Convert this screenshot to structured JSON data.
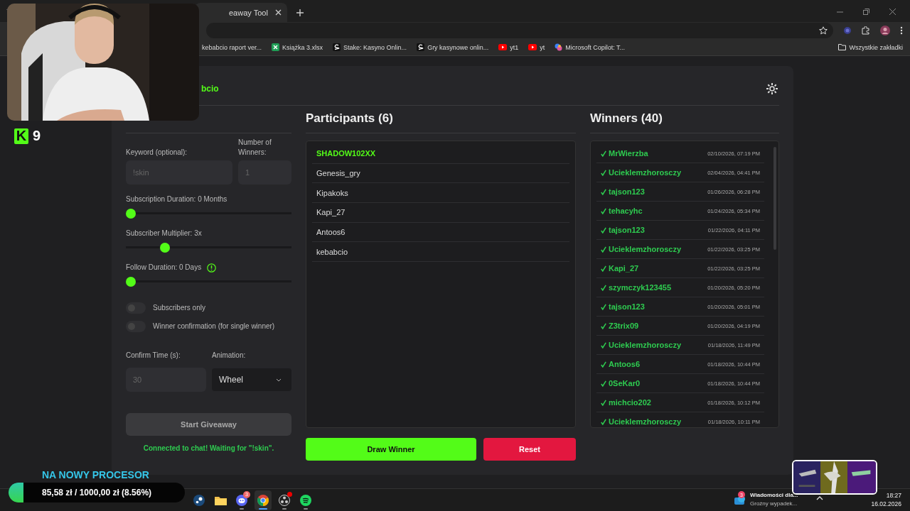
{
  "browser": {
    "tab_title": "eaway Tool",
    "bookmarks": [
      {
        "label": "kebabcio raport ver..."
      },
      {
        "label": "Książka 3.xlsx",
        "kind": "sheet"
      },
      {
        "label": "Stake: Kasyno Onlin...",
        "kind": "stake"
      },
      {
        "label": "Gry kasynowe onlin...",
        "kind": "stake"
      },
      {
        "label": "yt1",
        "kind": "video"
      },
      {
        "label": "yt",
        "kind": "video"
      },
      {
        "label": "Microsoft Copilot: T...",
        "kind": "copilot"
      }
    ],
    "all_bookmarks": "Wszystkie zakładki"
  },
  "page": {
    "title": "bcio",
    "settings": {
      "keyword_label": "Keyword (optional):",
      "keyword_placeholder": "!skin",
      "winners_label": "Number of Winners:",
      "winners_placeholder": "1",
      "sliders": [
        {
          "label": "Subscription Duration: 0 Months",
          "level": 0,
          "info": false
        },
        {
          "label": "Subscriber Multiplier: 3x",
          "level": 0.22,
          "info": false
        },
        {
          "label": "Follow Duration: 0 Days",
          "level": 0,
          "info": true
        }
      ],
      "toggles": [
        {
          "label": "Subscribers only",
          "on": false
        },
        {
          "label": "Winner confirmation (for single winner)",
          "on": false
        }
      ],
      "confirm_label": "Confirm Time (s):",
      "confirm_placeholder": "30",
      "animation_label": "Animation:",
      "animation_value": "Wheel",
      "start_button": "Start Giveaway",
      "start_disabled": true,
      "status": "Connected to chat! Waiting for \"!skin\"."
    },
    "participants": {
      "title": "Participants (6)",
      "items": [
        {
          "name": "SHADOW102XX",
          "selected": true
        },
        {
          "name": "Genesis_gry",
          "selected": false
        },
        {
          "name": "Kipakoks",
          "selected": false
        },
        {
          "name": "Kapi_27",
          "selected": false
        },
        {
          "name": "Antoos6",
          "selected": false
        },
        {
          "name": "kebabcio",
          "selected": false
        }
      ]
    },
    "draw_button": "Draw Winner",
    "reset_button": "Reset",
    "winners": {
      "title": "Winners (40)",
      "items": [
        {
          "name": "MrWierzba",
          "time": "02/10/2026, 07:19 PM"
        },
        {
          "name": "Ucieklemzhorosczy",
          "time": "02/04/2026, 04:41 PM"
        },
        {
          "name": "tajson123",
          "time": "01/26/2026, 06:28 PM"
        },
        {
          "name": "tehacyhc",
          "time": "01/24/2026, 05:34 PM"
        },
        {
          "name": "tajson123",
          "time": "01/22/2026, 04:11 PM"
        },
        {
          "name": "Ucieklemzhorosczy",
          "time": "01/22/2026, 03:25 PM"
        },
        {
          "name": "Kapi_27",
          "time": "01/22/2026, 03:25 PM"
        },
        {
          "name": "szymczyk123455",
          "time": "01/20/2026, 05:20 PM"
        },
        {
          "name": "tajson123",
          "time": "01/20/2026, 05:01 PM"
        },
        {
          "name": "Z3trix09",
          "time": "01/20/2026, 04:19 PM"
        },
        {
          "name": "Ucieklemzhorosczy",
          "time": "01/18/2026, 11:49 PM"
        },
        {
          "name": "Antoos6",
          "time": "01/18/2026, 10:44 PM"
        },
        {
          "name": "0SeKar0",
          "time": "01/18/2026, 10:44 PM"
        },
        {
          "name": "michcio202",
          "time": "01/18/2026, 10:12 PM"
        },
        {
          "name": "Ucieklemzhorosczy",
          "time": "01/18/2026, 10:11 PM"
        }
      ]
    }
  },
  "overlays": {
    "badge": {
      "logo": "K",
      "count": "9"
    },
    "goal": {
      "title": "NA NOWY PROCESOR",
      "text": "85,58 zł / 1000,00 zł (8.56%)",
      "level": 0.0856
    }
  },
  "taskbar": {
    "apps": [
      {
        "kind": "steam",
        "running": false,
        "selected": false
      },
      {
        "kind": "folder",
        "running": false,
        "selected": false
      },
      {
        "kind": "chat",
        "running": true,
        "selected": false,
        "badge": "3"
      },
      {
        "kind": "browser",
        "running": true,
        "selected": true
      },
      {
        "kind": "recorder",
        "running": true,
        "selected": false,
        "alert": true
      },
      {
        "kind": "music",
        "running": true,
        "selected": false
      }
    ],
    "news": {
      "count": "3",
      "title": "Wiadomości dla...",
      "subtitle": "Groźny wypadek..."
    },
    "time": "18:27",
    "date": "16.02.2026"
  }
}
